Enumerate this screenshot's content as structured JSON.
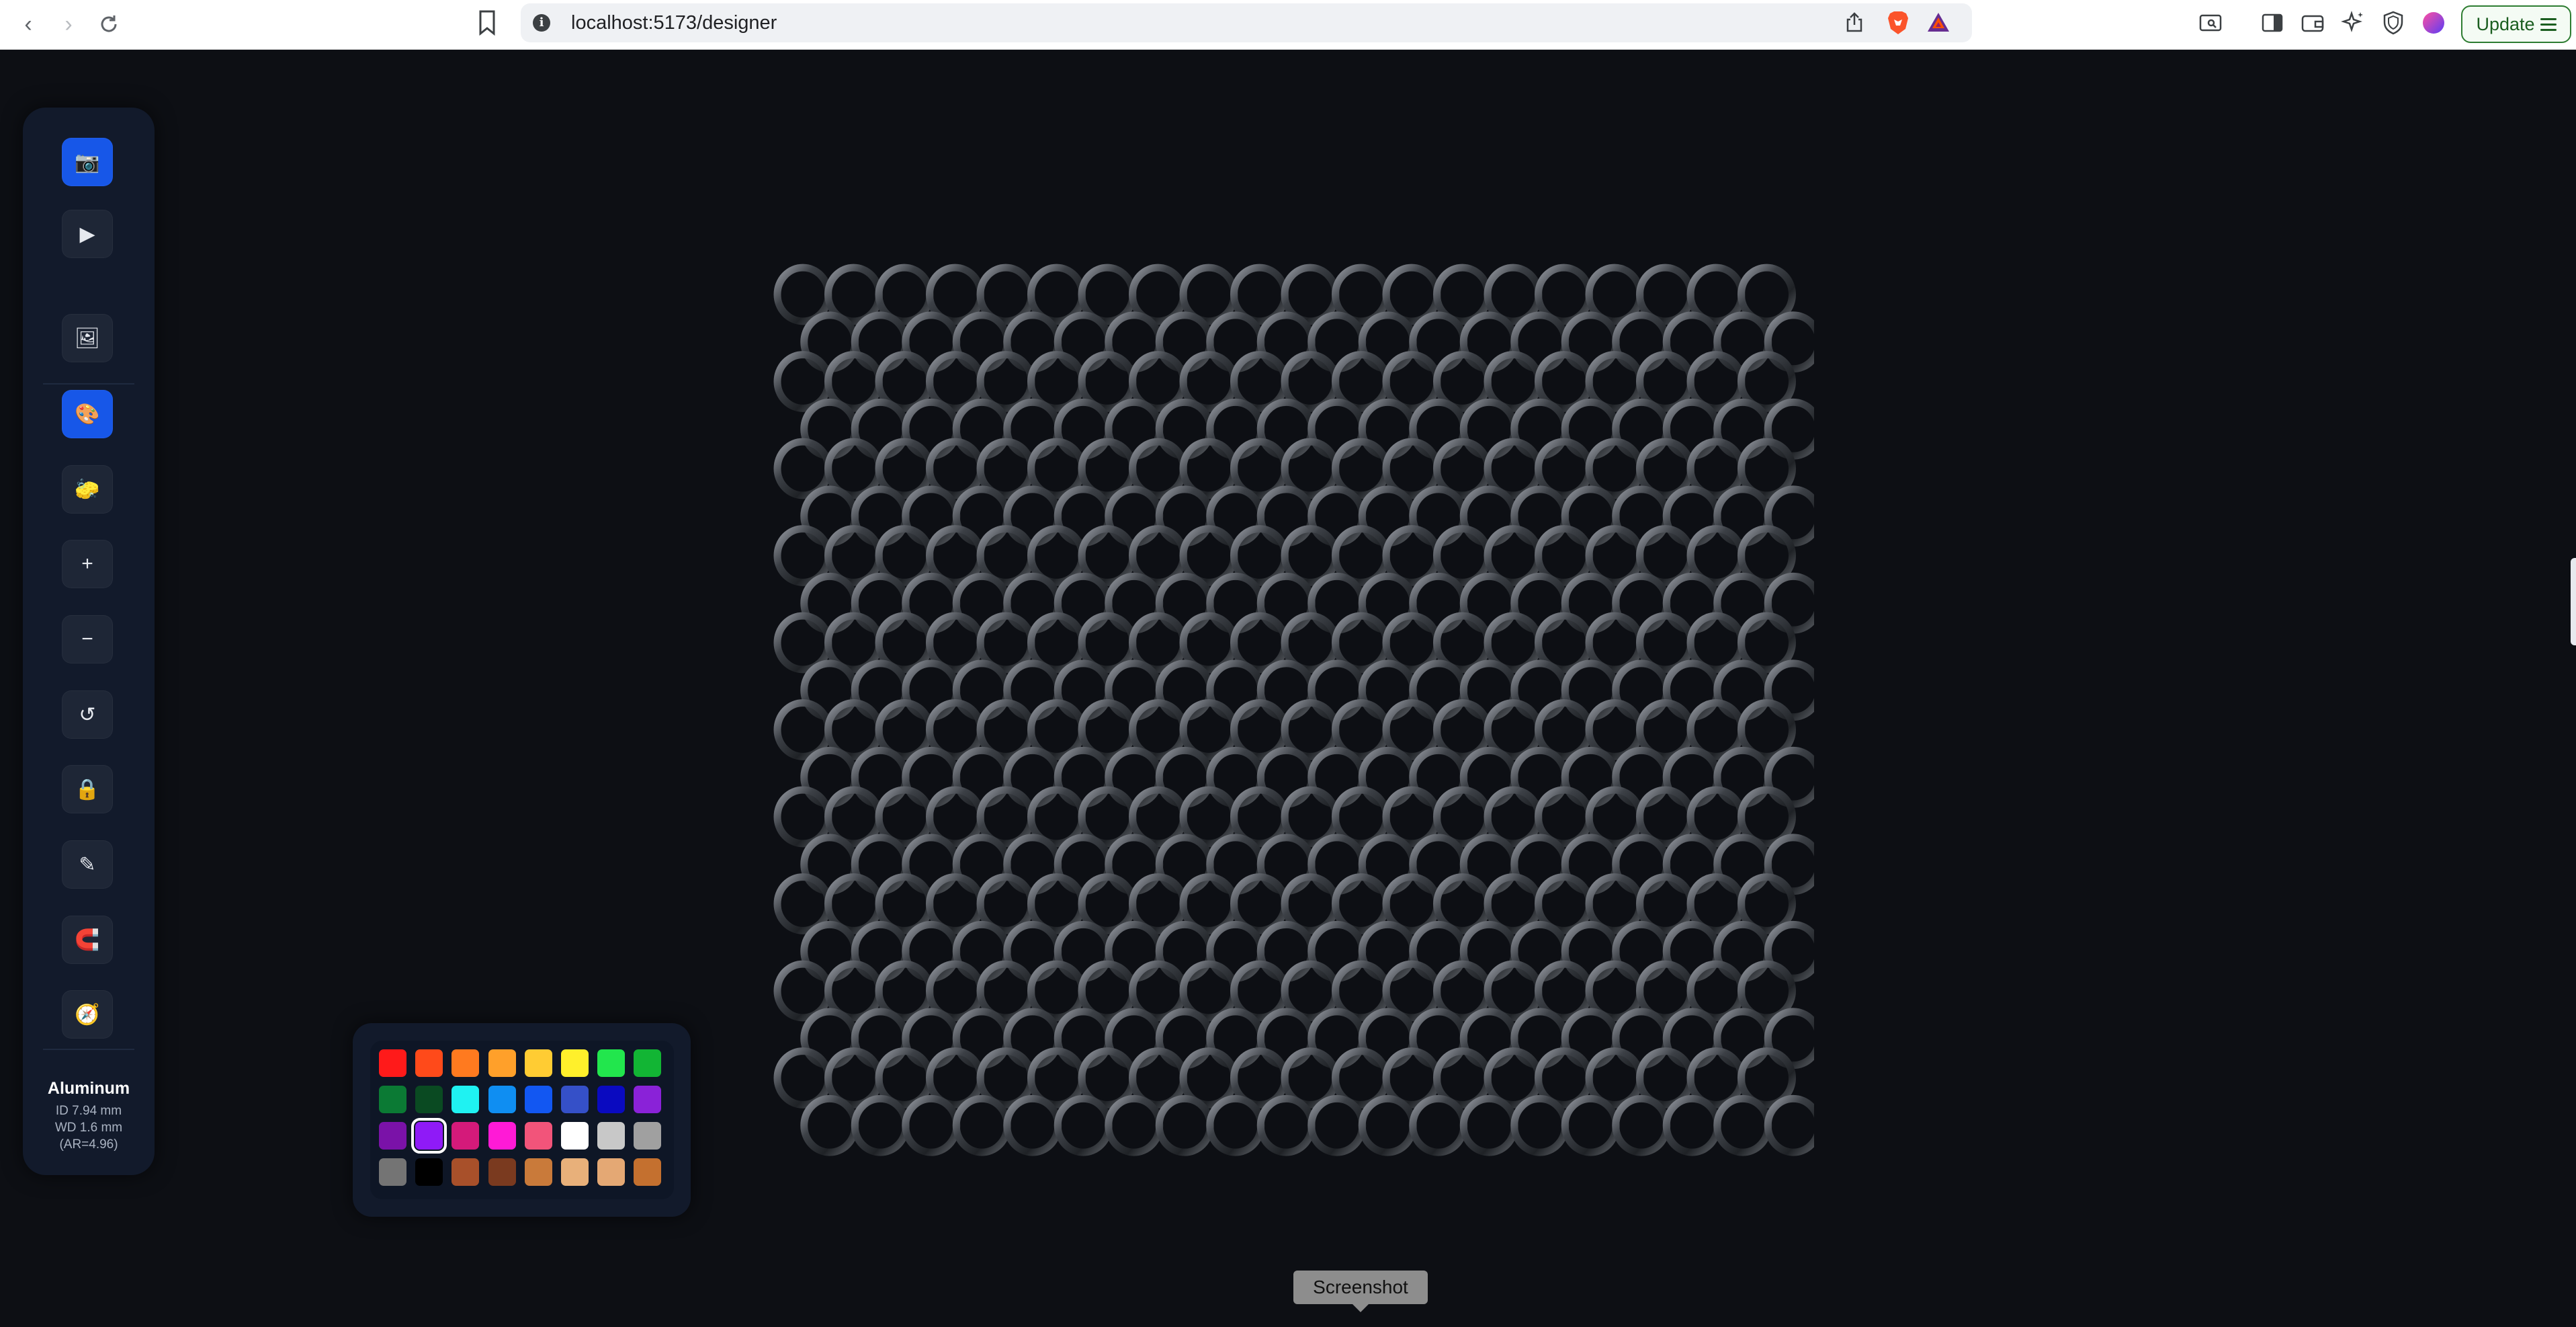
{
  "browser": {
    "url": "localhost:5173/designer",
    "update_label": "Update"
  },
  "sidebar": {
    "tools": [
      {
        "name": "camera-tool-button",
        "glyph": "📷",
        "active": true
      },
      {
        "name": "play-button",
        "glyph": "▶",
        "active": false
      },
      {
        "name": "image-tool-button",
        "glyph": "🖼",
        "active": false
      },
      {
        "name": "paint-tool-button",
        "glyph": "🎨",
        "active": true
      },
      {
        "name": "eraser-tool-button",
        "glyph": "🧽",
        "active": false
      },
      {
        "name": "zoom-in-button",
        "glyph": "+",
        "active": false
      },
      {
        "name": "zoom-out-button",
        "glyph": "−",
        "active": false
      },
      {
        "name": "reset-view-button",
        "glyph": "↺",
        "active": false
      },
      {
        "name": "lock-button",
        "glyph": "🔒",
        "active": false
      },
      {
        "name": "pick-tool-button",
        "glyph": "✎",
        "active": false
      },
      {
        "name": "magnet-button",
        "glyph": "🧲",
        "active": false
      },
      {
        "name": "compass-button",
        "glyph": "🧭",
        "active": false
      }
    ],
    "ring": {
      "material": "Aluminum",
      "id": "ID 7.94 mm",
      "wd": "WD 1.6 mm",
      "ar": "(AR=4.96)"
    }
  },
  "palette": {
    "colors": [
      [
        "#ff1a1a",
        "#ff4a1a",
        "#ff7a1f",
        "#ffa02a",
        "#ffcc33",
        "#fff02b",
        "#22e64d",
        "#12b534"
      ],
      [
        "#0b7a34",
        "#0a4a22",
        "#1ff2f2",
        "#0f8ef2",
        "#1257f2",
        "#3550c8",
        "#0a0ac0",
        "#8a22d8"
      ],
      [
        "#7a12a8",
        "#8f1af7",
        "#d41a7a",
        "#ff1ad6",
        "#f2547a",
        "#ffffff",
        "#c8c8c8",
        "#a0a0a0"
      ],
      [
        "#747474",
        "#000000",
        "#a8502a",
        "#7a3a1f",
        "#c97a3a",
        "#e8b07a",
        "#e4a874",
        "#c4702f"
      ]
    ],
    "selected": [
      2,
      1
    ]
  },
  "canvas": {
    "weave": "chainmail grid",
    "columns": 20,
    "rows": 10,
    "ring_color": "#3a3d42"
  },
  "tooltip": {
    "label": "Screenshot"
  }
}
